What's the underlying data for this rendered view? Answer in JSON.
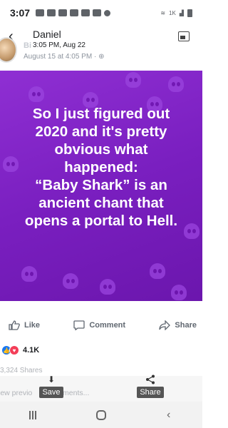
{
  "status_bar": {
    "time": "3:07",
    "right_indicator": "1K"
  },
  "header": {
    "name": "Daniel",
    "time": "3:05 PM, Aug 22",
    "sub_meta": "August 15 at 4:05 PM · ",
    "ghost_name_fragment": "Bi"
  },
  "post": {
    "text_lines": [
      "So I just figured out",
      "2020 and it's pretty",
      "obvious what",
      "happened:",
      "“Baby Shark” is an",
      "ancient chant that",
      "opens a portal to Hell."
    ],
    "colors": {
      "background": "#7a1fc0",
      "text": "#ffffff",
      "skull": "#9a44de"
    }
  },
  "actions": {
    "like": "Like",
    "comment": "Comment",
    "share": "Share"
  },
  "reactions": {
    "count": "4.1K",
    "types": [
      "like",
      "love"
    ]
  },
  "shares": "3,324 Shares",
  "overlay": {
    "prev_comments": "iew previo",
    "prev_comments_tail": "mments...",
    "save_label": "Save",
    "share_label": "Share"
  }
}
